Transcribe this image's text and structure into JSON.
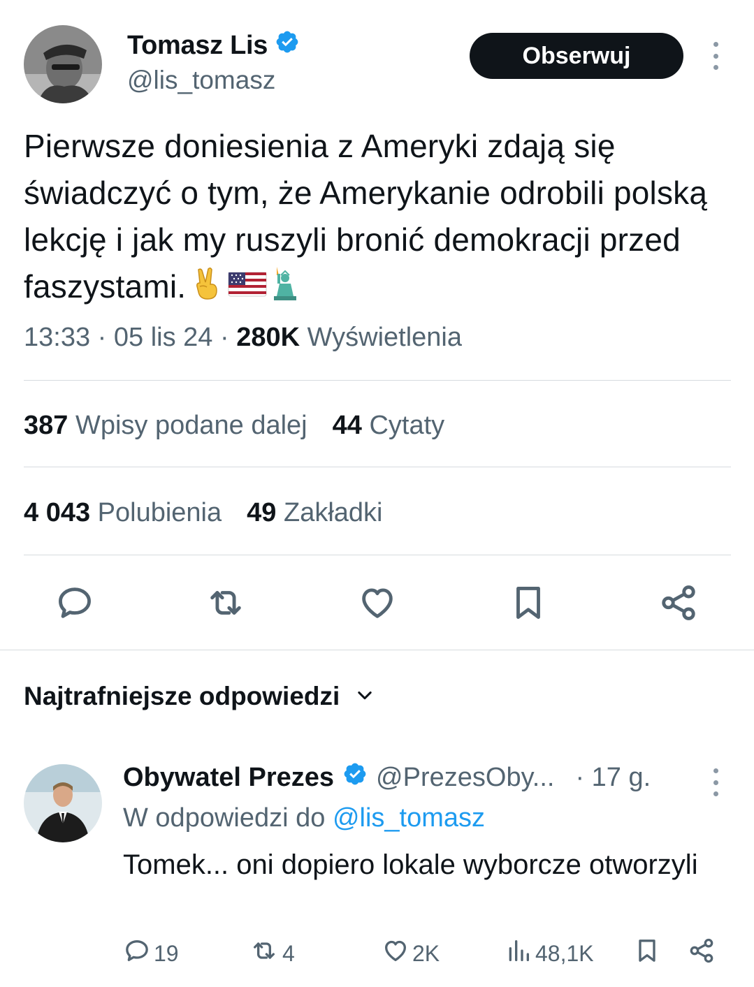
{
  "tweet": {
    "author_name": "Tomasz Lis",
    "author_handle": "@lis_tomasz",
    "verified": true,
    "follow_label": "Obserwuj",
    "text": "Pierwsze doniesienia z Ameryki zdają się świadczyć o tym, że Amerykanie odrobili polską lekcję i jak my ruszyli bronić demokracji przed faszystami.",
    "emojis": [
      "victory-hand",
      "us-flag",
      "statue-of-liberty"
    ],
    "time": "13:33",
    "date": "05 lis 24",
    "views_count": "280K",
    "views_label": "Wyświetlenia",
    "sep": "·"
  },
  "stats": {
    "reposts_count": "387",
    "reposts_label": "Wpisy podane dalej",
    "quotes_count": "44",
    "quotes_label": "Cytaty",
    "likes_count": "4 043",
    "likes_label": "Polubienia",
    "bookmarks_count": "49",
    "bookmarks_label": "Zakładki"
  },
  "actions": [
    "reply-icon",
    "repost-icon",
    "like-icon",
    "bookmark-icon",
    "share-icon"
  ],
  "replies_header": "Najtrafniejsze odpowiedzi",
  "reply": {
    "author_name": "Obywatel Prezes",
    "author_handle": "@PrezesOby...",
    "verified": true,
    "time": "· 17 g.",
    "reply_to_prefix": "W odpowiedzi do",
    "reply_to_handle": "@lis_tomasz",
    "text": "Tomek... oni dopiero lokale wyborcze otworzyli",
    "counts": {
      "replies": "19",
      "reposts": "4",
      "likes": "2K",
      "views": "48,1K"
    }
  },
  "colors": {
    "text": "#0f1419",
    "secondary": "#536471",
    "link": "#1d9bf0",
    "verified": "#1d9bf0",
    "divider": "#d6dbdf",
    "button_bg": "#0f1419"
  }
}
